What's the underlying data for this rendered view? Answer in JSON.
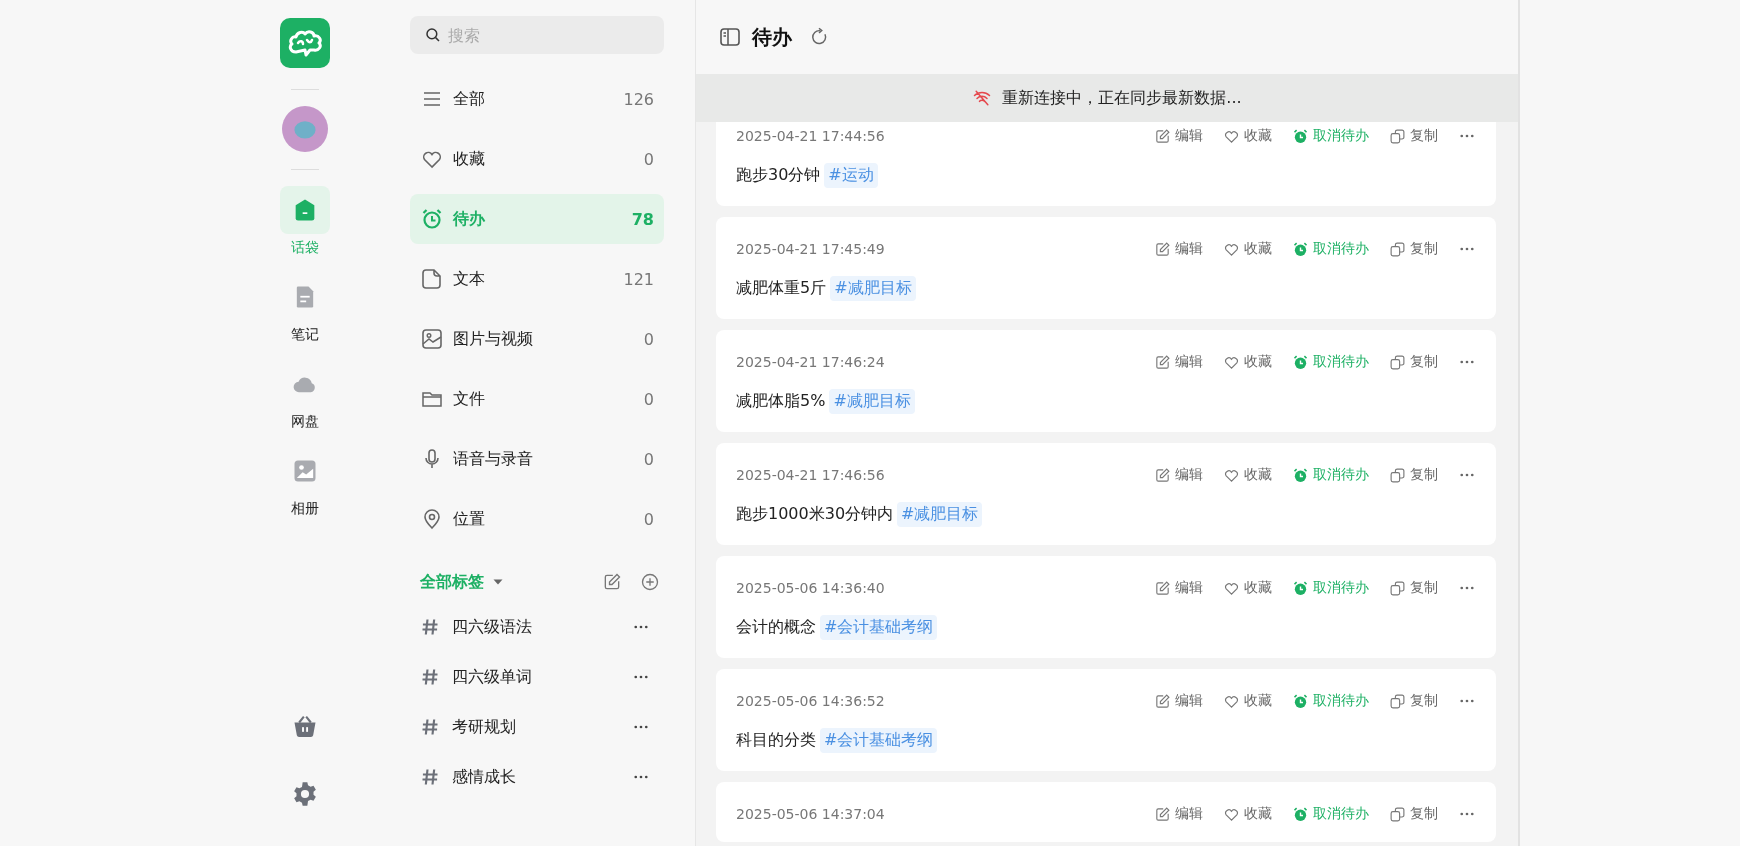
{
  "rail": {
    "items": [
      {
        "kind": "home",
        "label": "话袋",
        "selected": true
      },
      {
        "kind": "note",
        "label": "笔记",
        "selected": false
      },
      {
        "kind": "cloud",
        "label": "网盘",
        "selected": false
      },
      {
        "kind": "album",
        "label": "相册",
        "selected": false
      }
    ]
  },
  "sidebar": {
    "search": {
      "placeholder": "搜索"
    },
    "categories": [
      {
        "kind": "all",
        "label": "全部",
        "count": "126",
        "selected": false
      },
      {
        "kind": "favorite",
        "label": "收藏",
        "count": "0",
        "selected": false
      },
      {
        "kind": "todo",
        "label": "待办",
        "count": "78",
        "selected": true
      },
      {
        "kind": "text",
        "label": "文本",
        "count": "121",
        "selected": false
      },
      {
        "kind": "media",
        "label": "图片与视频",
        "count": "0",
        "selected": false
      },
      {
        "kind": "file",
        "label": "文件",
        "count": "0",
        "selected": false
      },
      {
        "kind": "voice",
        "label": "语音与录音",
        "count": "0",
        "selected": false
      },
      {
        "kind": "location",
        "label": "位置",
        "count": "0",
        "selected": false
      }
    ],
    "tags_header": {
      "label": "全部标签"
    },
    "tags": [
      {
        "label": "四六级语法"
      },
      {
        "label": "四六级单词"
      },
      {
        "label": "考研规划"
      },
      {
        "label": "感情成长"
      }
    ]
  },
  "main": {
    "title": "待办",
    "banner": {
      "message": "重新连接中，正在同步最新数据..."
    },
    "notes": [
      {
        "time": "2025-04-21 17:44:56",
        "text": "跑步30分钟",
        "tag": "#运动",
        "actions": [
          {
            "kind": "edit",
            "label": "编辑"
          },
          {
            "kind": "favorite",
            "label": "收藏"
          },
          {
            "kind": "todo",
            "label": "取消待办"
          },
          {
            "kind": "copy",
            "label": "复制"
          }
        ]
      },
      {
        "time": "2025-04-21 17:45:49",
        "text": "减肥体重5斤",
        "tag": "#减肥目标",
        "actions": [
          {
            "kind": "edit",
            "label": "编辑"
          },
          {
            "kind": "favorite",
            "label": "收藏"
          },
          {
            "kind": "todo",
            "label": "取消待办"
          },
          {
            "kind": "copy",
            "label": "复制"
          }
        ]
      },
      {
        "time": "2025-04-21 17:46:24",
        "text": "减肥体脂5%",
        "tag": "#减肥目标",
        "actions": [
          {
            "kind": "edit",
            "label": "编辑"
          },
          {
            "kind": "favorite",
            "label": "收藏"
          },
          {
            "kind": "todo",
            "label": "取消待办"
          },
          {
            "kind": "copy",
            "label": "复制"
          }
        ]
      },
      {
        "time": "2025-04-21 17:46:56",
        "text": "跑步1000米30分钟内",
        "tag": "#减肥目标",
        "actions": [
          {
            "kind": "edit",
            "label": "编辑"
          },
          {
            "kind": "favorite",
            "label": "收藏"
          },
          {
            "kind": "todo",
            "label": "取消待办"
          },
          {
            "kind": "copy",
            "label": "复制"
          }
        ]
      },
      {
        "time": "2025-05-06 14:36:40",
        "text": "会计的概念",
        "tag": "#会计基础考纲",
        "actions": [
          {
            "kind": "edit",
            "label": "编辑"
          },
          {
            "kind": "favorite",
            "label": "收藏"
          },
          {
            "kind": "todo",
            "label": "取消待办"
          },
          {
            "kind": "copy",
            "label": "复制"
          }
        ]
      },
      {
        "time": "2025-05-06 14:36:52",
        "text": "科目的分类",
        "tag": "#会计基础考纲",
        "actions": [
          {
            "kind": "edit",
            "label": "编辑"
          },
          {
            "kind": "favorite",
            "label": "收藏"
          },
          {
            "kind": "todo",
            "label": "取消待办"
          },
          {
            "kind": "copy",
            "label": "复制"
          }
        ]
      },
      {
        "time": "2025-05-06 14:37:04",
        "actions": [
          {
            "kind": "edit",
            "label": "编辑"
          },
          {
            "kind": "favorite",
            "label": "收藏"
          },
          {
            "kind": "todo",
            "label": "取消待办"
          },
          {
            "kind": "copy",
            "label": "复制"
          }
        ]
      }
    ]
  }
}
